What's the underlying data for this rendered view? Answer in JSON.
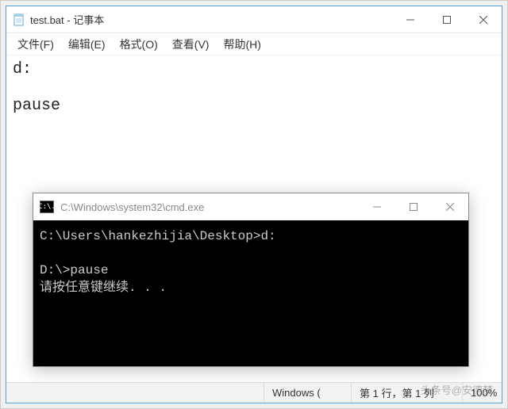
{
  "notepad": {
    "title": "test.bat - 记事本",
    "menu": {
      "file": "文件(F)",
      "edit": "编辑(E)",
      "format": "格式(O)",
      "view": "查看(V)",
      "help": "帮助(H)"
    },
    "content": "d:\n\npause",
    "status": {
      "os": "Windows (",
      "position": "第 1 行，第 1 列",
      "zoom": "100%"
    }
  },
  "cmd": {
    "title": "C:\\Windows\\system32\\cmd.exe",
    "icon_label": "C:\\.",
    "body": "C:\\Users\\hankezhijia\\Desktop>d:\n\nD:\\>pause\n请按任意键继续. . ."
  },
  "watermark": "头条号@安德梦"
}
